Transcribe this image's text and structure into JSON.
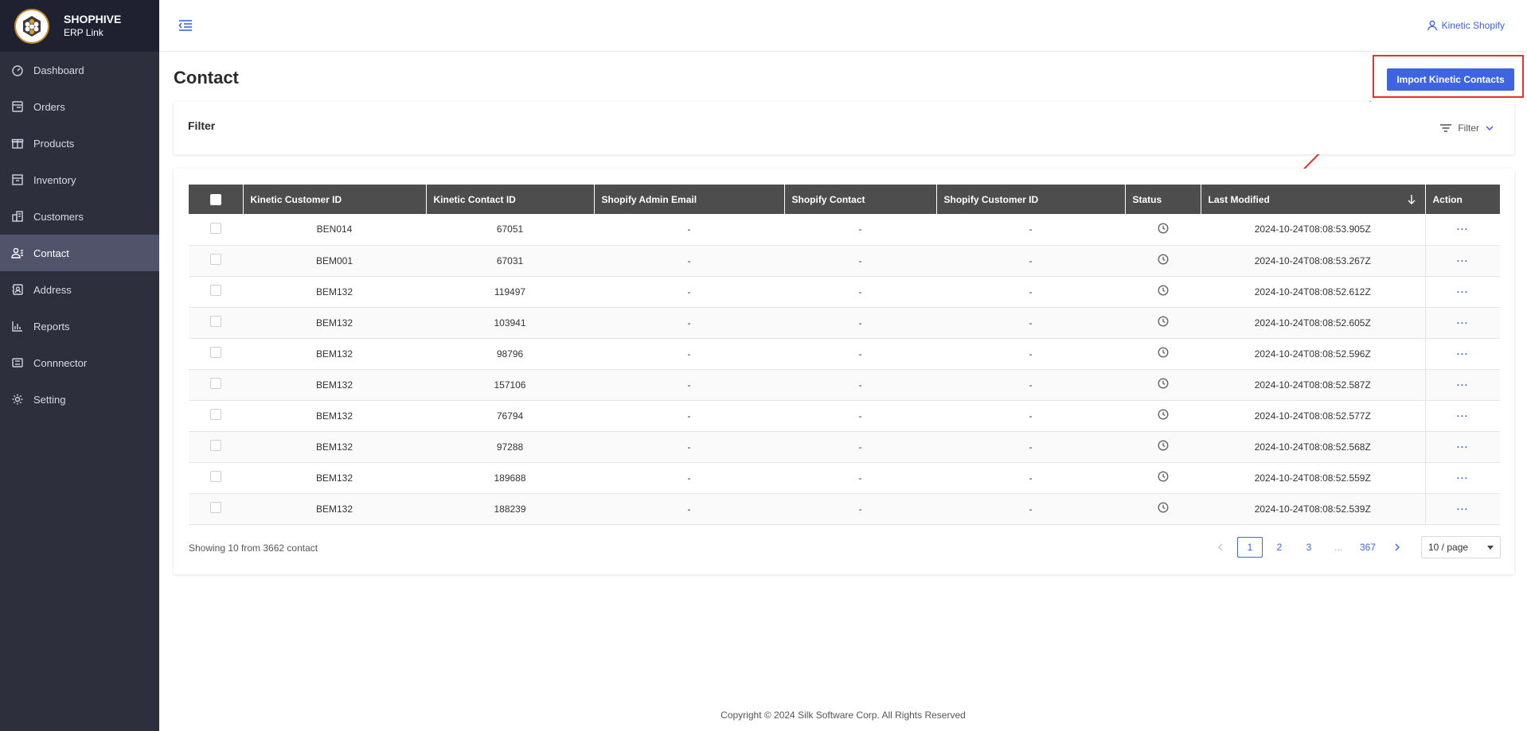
{
  "brand": {
    "name": "SHOPHIVE",
    "sub": "ERP Link"
  },
  "sidebar": {
    "items": [
      {
        "label": "Dashboard",
        "icon": "dashboard-icon",
        "active": false
      },
      {
        "label": "Orders",
        "icon": "orders-icon",
        "active": false
      },
      {
        "label": "Products",
        "icon": "products-icon",
        "active": false
      },
      {
        "label": "Inventory",
        "icon": "inventory-icon",
        "active": false
      },
      {
        "label": "Customers",
        "icon": "customers-icon",
        "active": false
      },
      {
        "label": "Contact",
        "icon": "contact-icon",
        "active": true
      },
      {
        "label": "Address",
        "icon": "address-icon",
        "active": false
      },
      {
        "label": "Reports",
        "icon": "reports-icon",
        "active": false
      },
      {
        "label": "Connnector",
        "icon": "connector-icon",
        "active": false
      },
      {
        "label": "Setting",
        "icon": "gear-icon",
        "active": false
      }
    ]
  },
  "header": {
    "user": "Kinetic Shopify"
  },
  "page": {
    "title": "Contact",
    "import_label": "Import Kinetic Contacts",
    "filter_title": "Filter",
    "filter_button": "Filter"
  },
  "table": {
    "columns": [
      "Kinetic Customer ID",
      "Kinetic Contact ID",
      "Shopify Admin Email",
      "Shopify Contact",
      "Shopify Customer ID",
      "Status",
      "Last Modified",
      "Action"
    ],
    "rows": [
      {
        "customer_id": "BEN014",
        "contact_id": "67051",
        "email": "-",
        "contact": "-",
        "shopify_customer_id": "-",
        "modified": "2024-10-24T08:08:53.905Z",
        "action": "···"
      },
      {
        "customer_id": "BEM001",
        "contact_id": "67031",
        "email": "-",
        "contact": "-",
        "shopify_customer_id": "-",
        "modified": "2024-10-24T08:08:53.267Z",
        "action": "···"
      },
      {
        "customer_id": "BEM132",
        "contact_id": "119497",
        "email": "-",
        "contact": "-",
        "shopify_customer_id": "-",
        "modified": "2024-10-24T08:08:52.612Z",
        "action": "···"
      },
      {
        "customer_id": "BEM132",
        "contact_id": "103941",
        "email": "-",
        "contact": "-",
        "shopify_customer_id": "-",
        "modified": "2024-10-24T08:08:52.605Z",
        "action": "···"
      },
      {
        "customer_id": "BEM132",
        "contact_id": "98796",
        "email": "-",
        "contact": "-",
        "shopify_customer_id": "-",
        "modified": "2024-10-24T08:08:52.596Z",
        "action": "···"
      },
      {
        "customer_id": "BEM132",
        "contact_id": "157106",
        "email": "-",
        "contact": "-",
        "shopify_customer_id": "-",
        "modified": "2024-10-24T08:08:52.587Z",
        "action": "···"
      },
      {
        "customer_id": "BEM132",
        "contact_id": "76794",
        "email": "-",
        "contact": "-",
        "shopify_customer_id": "-",
        "modified": "2024-10-24T08:08:52.577Z",
        "action": "···"
      },
      {
        "customer_id": "BEM132",
        "contact_id": "97288",
        "email": "-",
        "contact": "-",
        "shopify_customer_id": "-",
        "modified": "2024-10-24T08:08:52.568Z",
        "action": "···"
      },
      {
        "customer_id": "BEM132",
        "contact_id": "189688",
        "email": "-",
        "contact": "-",
        "shopify_customer_id": "-",
        "modified": "2024-10-24T08:08:52.559Z",
        "action": "···"
      },
      {
        "customer_id": "BEM132",
        "contact_id": "188239",
        "email": "-",
        "contact": "-",
        "shopify_customer_id": "-",
        "modified": "2024-10-24T08:08:52.539Z",
        "action": "···"
      }
    ]
  },
  "pagination": {
    "summary": "Showing 10 from 3662 contact",
    "pages": [
      "1",
      "2",
      "3",
      "...",
      "367"
    ],
    "current": "1",
    "page_size": "10 / page"
  },
  "footer": {
    "copyright": "Copyright © 2024 Silk Software Corp. All Rights Reserved"
  },
  "colors": {
    "accent": "#3e64e4",
    "sidebar": "#2d2f3d",
    "highlight": "#e8322a"
  }
}
